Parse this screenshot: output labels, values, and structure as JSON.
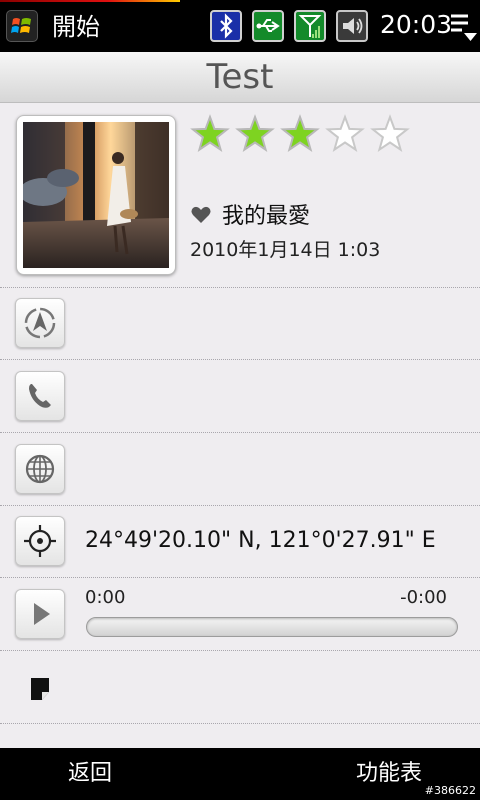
{
  "status_bar": {
    "start_label": "開始",
    "time": "20:03",
    "icons": [
      "windows-logo-icon",
      "bluetooth-icon",
      "usb-icon",
      "signal-icon",
      "volume-icon",
      "menu-dropdown-icon"
    ]
  },
  "title": "Test",
  "rating": {
    "value": 3,
    "max": 5
  },
  "favorite": {
    "icon": "heart-icon",
    "label": "我的最愛"
  },
  "date": "2010年1月14日 1:03",
  "rows": [
    {
      "icon": "navigation-icon"
    },
    {
      "icon": "phone-icon"
    },
    {
      "icon": "globe-icon"
    },
    {
      "icon": "location-target-icon",
      "text": "24°49'20.10\" N, 121°0'27.91\" E"
    },
    {
      "icon": "play-icon"
    },
    {
      "icon": "note-icon"
    }
  ],
  "audio": {
    "elapsed": "0:00",
    "remaining": "-0:00",
    "progress": 0
  },
  "softkeys": {
    "left": "返回",
    "right": "功能表"
  },
  "watermark": "#386622",
  "colors": {
    "star_filled": "#7ed321",
    "accent": "#3a86d6"
  }
}
